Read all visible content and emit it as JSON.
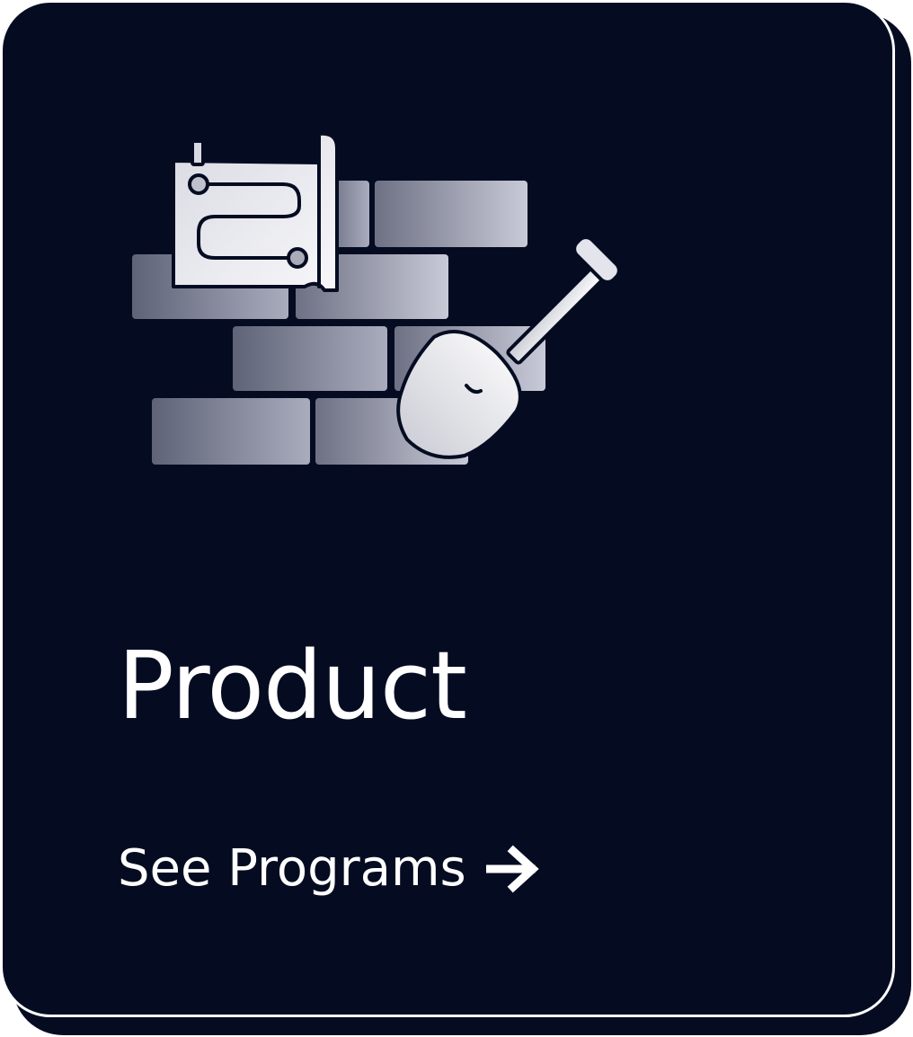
{
  "card": {
    "title": "Product",
    "cta_label": "See Programs",
    "cta_icon": "arrow-right-icon",
    "illustration_icon": "brick-wall-blueprint-shovel-icon"
  },
  "colors": {
    "card_background": "#050c22",
    "card_border": "#ffffff",
    "text": "#ffffff"
  }
}
